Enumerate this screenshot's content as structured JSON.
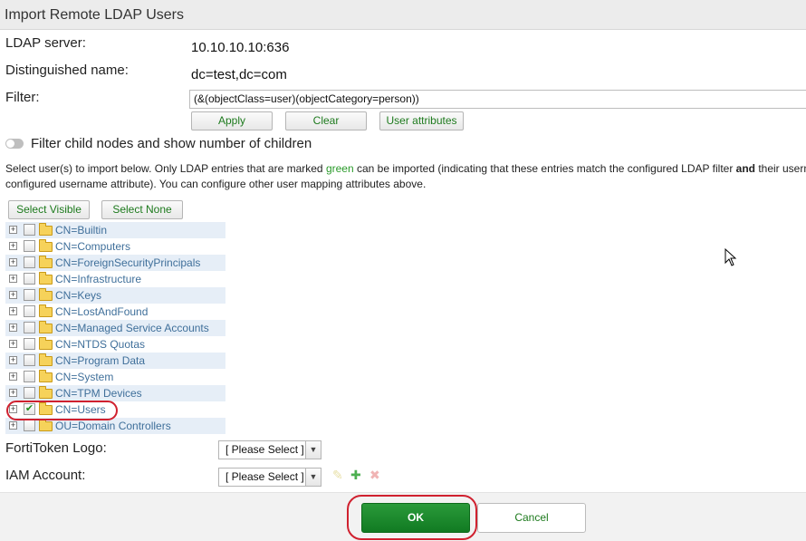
{
  "dialog": {
    "title": "Import Remote LDAP Users"
  },
  "fields": {
    "ldap_server_label": "LDAP server:",
    "ldap_server_value": "10.10.10.10:636",
    "dn_label": "Distinguished name:",
    "dn_value": "dc=test,dc=com",
    "filter_label": "Filter:",
    "filter_value": "(&(objectClass=user)(objectCategory=person))"
  },
  "filter_buttons": {
    "apply": "Apply",
    "clear": "Clear",
    "user_attributes": "User attributes"
  },
  "toggle": {
    "label": "Filter child nodes and show number of children",
    "on": false
  },
  "instructions": {
    "part1": "Select user(s) to import below. Only LDAP entries that are marked ",
    "green_word": "green",
    "part2": " can be imported (indicating that these entries match the configured LDAP filter ",
    "bold_word": "and",
    "part3": " their userna",
    "line2": "configured username attribute). You can configure other user mapping attributes above."
  },
  "select_buttons": {
    "visible": "Select Visible",
    "none": "Select None"
  },
  "tree": {
    "items": [
      {
        "label": "CN=Builtin",
        "checked": false
      },
      {
        "label": "CN=Computers",
        "checked": false
      },
      {
        "label": "CN=ForeignSecurityPrincipals",
        "checked": false
      },
      {
        "label": "CN=Infrastructure",
        "checked": false
      },
      {
        "label": "CN=Keys",
        "checked": false
      },
      {
        "label": "CN=LostAndFound",
        "checked": false
      },
      {
        "label": "CN=Managed Service Accounts",
        "checked": false
      },
      {
        "label": "CN=NTDS Quotas",
        "checked": false
      },
      {
        "label": "CN=Program Data",
        "checked": false
      },
      {
        "label": "CN=System",
        "checked": false
      },
      {
        "label": "CN=TPM Devices",
        "checked": false
      },
      {
        "label": "CN=Users",
        "checked": true
      },
      {
        "label": "OU=Domain Controllers",
        "checked": false
      }
    ]
  },
  "fortitoken": {
    "label": "FortiToken Logo:",
    "value": "[ Please Select ]"
  },
  "iam": {
    "label": "IAM Account:",
    "value": "[ Please Select ]"
  },
  "footer": {
    "ok": "OK",
    "cancel": "Cancel"
  },
  "colors": {
    "accent_green": "#117a22",
    "highlight_red": "#d0212f",
    "tree_label": "#3f6f9a"
  },
  "icons": [
    "expander-plus-icon",
    "checkbox-icon",
    "folder-icon",
    "edit-icon",
    "add-icon",
    "delete-icon",
    "chevron-down-icon",
    "mouse-cursor-icon"
  ]
}
